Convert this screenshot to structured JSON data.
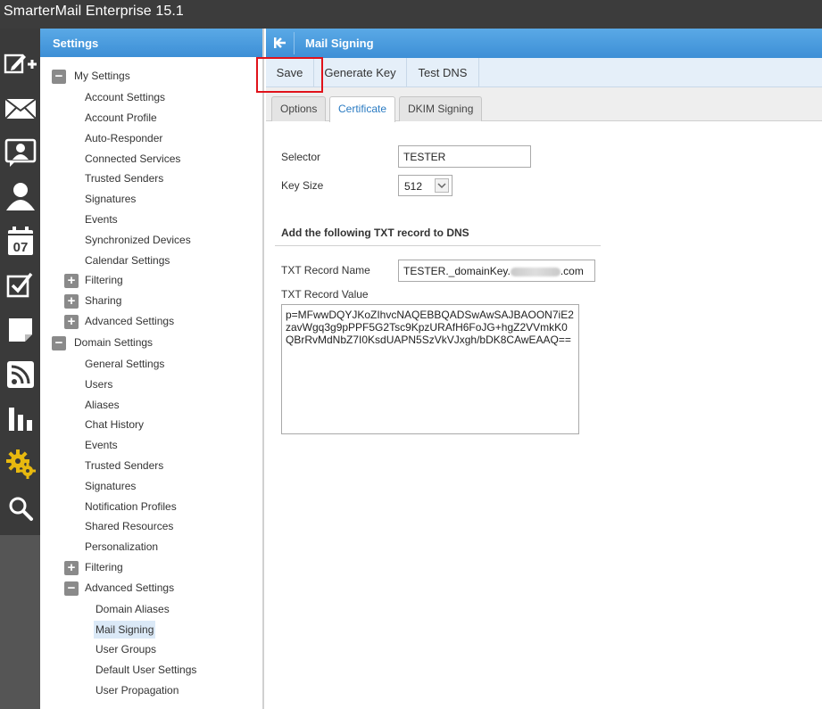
{
  "app": {
    "title": "SmarterMail Enterprise 15.1"
  },
  "rail": {
    "items": [
      {
        "icon": "compose-icon"
      },
      {
        "icon": "mail-icon"
      },
      {
        "icon": "contacts-icon"
      },
      {
        "icon": "user-icon"
      },
      {
        "icon": "calendar-icon",
        "label": "07"
      },
      {
        "icon": "tasks-icon"
      },
      {
        "icon": "notes-icon"
      },
      {
        "icon": "rss-icon"
      },
      {
        "icon": "reports-icon"
      },
      {
        "icon": "settings-gear-icon"
      },
      {
        "icon": "search-icon"
      }
    ]
  },
  "settings_panel": {
    "title": "Settings",
    "tree": {
      "my_settings": {
        "label": "My Settings",
        "toggle": "−",
        "items": [
          "Account Settings",
          "Account Profile",
          "Auto-Responder",
          "Connected Services",
          "Trusted Senders",
          "Signatures",
          "Events",
          "Synchronized Devices",
          "Calendar Settings"
        ],
        "filtering": {
          "label": "Filtering",
          "toggle": "+"
        },
        "sharing": {
          "label": "Sharing",
          "toggle": "+"
        },
        "advanced": {
          "label": "Advanced Settings",
          "toggle": "+"
        }
      },
      "domain_settings": {
        "label": "Domain Settings",
        "toggle": "−",
        "items": [
          "General Settings",
          "Users",
          "Aliases",
          "Chat History",
          "Events",
          "Trusted Senders",
          "Signatures",
          "Notification Profiles",
          "Shared Resources",
          "Personalization"
        ],
        "filtering": {
          "label": "Filtering",
          "toggle": "+"
        },
        "advanced": {
          "label": "Advanced Settings",
          "toggle": "−",
          "items": [
            "Domain Aliases",
            "Mail Signing",
            "User Groups",
            "Default User Settings",
            "User Propagation"
          ],
          "selected": "Mail Signing"
        }
      }
    }
  },
  "content": {
    "title": "Mail Signing",
    "toolbar": {
      "save": "Save",
      "generate_key": "Generate Key",
      "test_dns": "Test DNS"
    },
    "tabs": [
      {
        "label": "Options",
        "active": false
      },
      {
        "label": "Certificate",
        "active": true
      },
      {
        "label": "DKIM Signing",
        "active": false
      }
    ],
    "form": {
      "selector_label": "Selector",
      "selector_value": "TESTER",
      "key_size_label": "Key Size",
      "key_size_value": "512",
      "section_title": "Add the following TXT record to DNS",
      "txt_record_name_label": "TXT Record Name",
      "txt_record_name_prefix": "TESTER._domainKey.",
      "txt_record_name_suffix": ".com",
      "txt_record_value_label": "TXT Record Value",
      "txt_record_value": "p=MFwwDQYJKoZIhvcNAQEBBQADSwAwSAJBAOON7iE2zavWgq3g9pPPF5G2Tsc9KpzURAfH6FoJG+hgZ2VVmkK0QBrRvMdNbZ7I0KsdUAPN5SzVkVJxgh/bDK8CAwEAAQ=="
    }
  },
  "colors": {
    "accent": "#3d8fd6",
    "highlight_box": "#e0121a",
    "gear": "#e8b90f"
  }
}
